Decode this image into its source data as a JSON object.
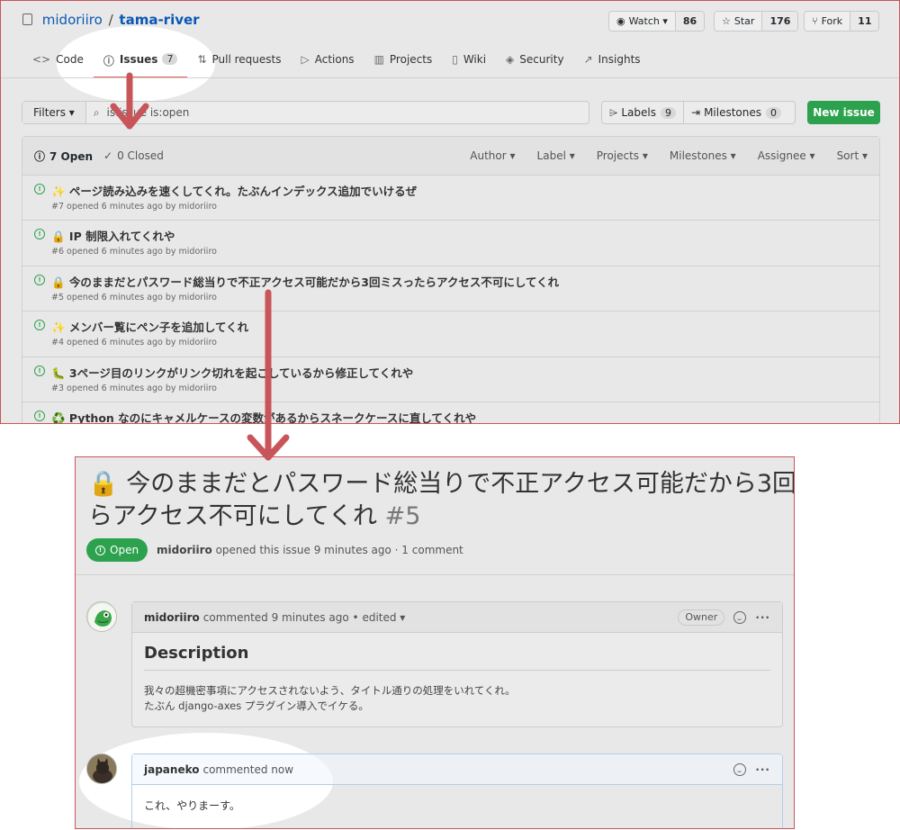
{
  "repo": {
    "owner": "midoriiro",
    "slash": "/",
    "name": "tama-river"
  },
  "repo_buttons": [
    {
      "label": "Watch ▾",
      "count": "86",
      "icon": "eye-icon"
    },
    {
      "label": "Star",
      "count": "176",
      "icon": "star-icon"
    },
    {
      "label": "Fork",
      "count": "11",
      "icon": "fork-icon"
    }
  ],
  "tabs": [
    {
      "icon": "code-icon",
      "glyph": "<>",
      "label": "Code"
    },
    {
      "icon": "issue-opened-icon",
      "glyph": "ⓘ",
      "label": "Issues",
      "badge": "7",
      "selected": true
    },
    {
      "icon": "pull-request-icon",
      "glyph": "⇅",
      "label": "Pull requests"
    },
    {
      "icon": "play-icon",
      "glyph": "▷",
      "label": "Actions"
    },
    {
      "icon": "project-icon",
      "glyph": "▥",
      "label": "Projects"
    },
    {
      "icon": "book-icon",
      "glyph": "▯",
      "label": "Wiki"
    },
    {
      "icon": "shield-icon",
      "glyph": "◈",
      "label": "Security"
    },
    {
      "icon": "graph-icon",
      "glyph": "↗",
      "label": "Insights"
    }
  ],
  "filters": {
    "button": "Filters ▾",
    "query": "is:issue is:open"
  },
  "labels": {
    "label": "Labels",
    "count": "9"
  },
  "milestones": {
    "label": "Milestones",
    "count": "0"
  },
  "new_issue": "New issue",
  "issues_head": {
    "open": "7 Open",
    "closed": "0 Closed",
    "filters": [
      "Author ▾",
      "Label ▾",
      "Projects ▾",
      "Milestones ▾",
      "Assignee ▾",
      "Sort ▾"
    ]
  },
  "issues": [
    {
      "title": "✨ ページ読み込みを速くしてくれ。たぶんインデックス追加でいけるぜ",
      "meta": "#7 opened 6 minutes ago by midoriiro"
    },
    {
      "title": "🔒 IP 制限入れてくれや",
      "meta": "#6 opened 6 minutes ago by midoriiro"
    },
    {
      "title": "🔒 今のままだとパスワード総当りで不正アクセス可能だから3回ミスったらアクセス不可にしてくれ",
      "meta": "#5 opened 6 minutes ago by midoriiro"
    },
    {
      "title": "✨ メンバー覧にペン子を追加してくれ",
      "meta": "#4 opened 6 minutes ago by midoriiro"
    },
    {
      "title": "🐛 3ページ目のリンクがリンク切れを起こしているから修正してくれや",
      "meta": "#3 opened 6 minutes ago by midoriiro"
    },
    {
      "title": "♻️ Python なのにキャメルケースの変数があるからスネークケースに直してくれや",
      "meta": ""
    }
  ],
  "detail": {
    "title_line1": "🔒 今のままだとパスワード総当りで不正アクセス可能だから3回",
    "title_line2": "らアクセス不可にしてくれ",
    "number": "#5",
    "status": "Open",
    "author": "midoriiro",
    "meta_rest": "opened this issue 9 minutes ago · 1 comment"
  },
  "comment1": {
    "author": "midoriiro",
    "meta": "commented 9 minutes ago • edited ▾",
    "badge": "Owner",
    "heading": "Description",
    "line1": "我々の超機密事項にアクセスされないよう、タイトル通りの処理をいれてくれ。",
    "line2": "たぶん django-axes プラグイン導入でイケる。"
  },
  "comment2": {
    "author": "japaneko",
    "meta": "commented now",
    "body": "これ、やりまーす。"
  },
  "colors": {
    "accent_green": "#2da24e",
    "arrow_red": "#c8555a",
    "link_blue": "#0a58b5"
  }
}
